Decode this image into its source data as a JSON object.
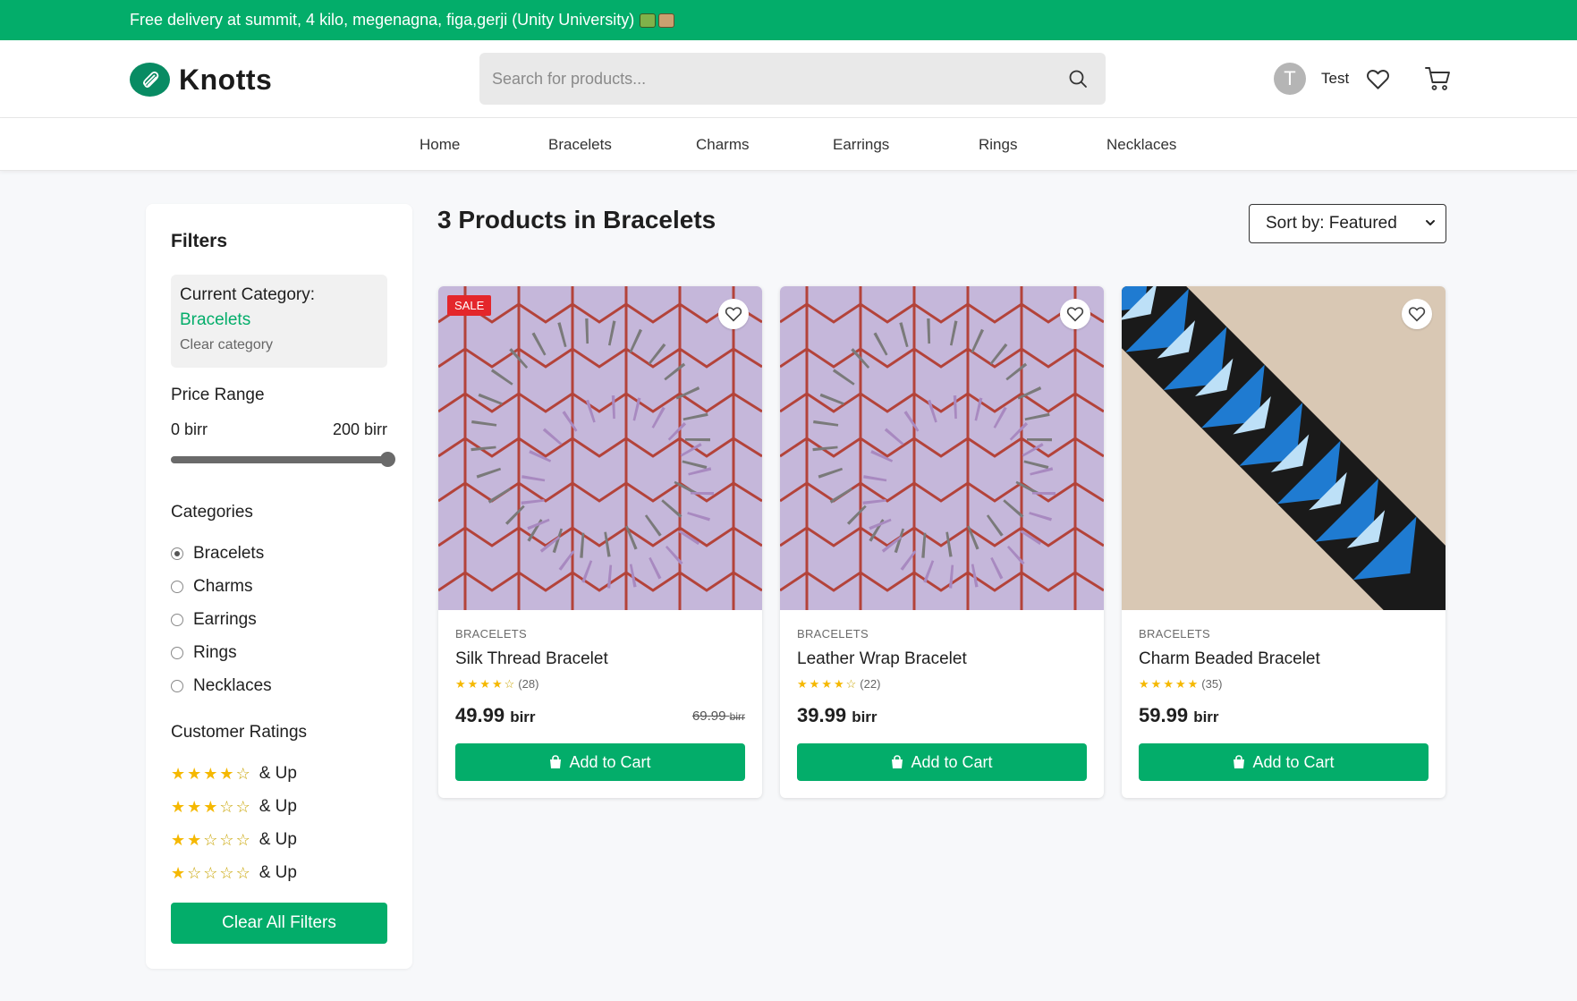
{
  "announcement": {
    "text": "Free delivery at summit, 4 kilo, megenagna, figa,gerji (Unity University)"
  },
  "header": {
    "brand": "Knotts",
    "search": {
      "placeholder": "Search for products..."
    },
    "user": {
      "initial": "T",
      "name": "Test"
    }
  },
  "nav": {
    "items": [
      {
        "label": "Home"
      },
      {
        "label": "Bracelets"
      },
      {
        "label": "Charms"
      },
      {
        "label": "Earrings"
      },
      {
        "label": "Rings"
      },
      {
        "label": "Necklaces"
      }
    ]
  },
  "sidebar": {
    "title": "Filters",
    "current_category_label": "Current Category:",
    "current_category": "Bracelets",
    "clear_category": "Clear category",
    "price_range_title": "Price Range",
    "price_min": "0 birr",
    "price_max": "200 birr",
    "price_slider_fraction": 1.0,
    "categories_title": "Categories",
    "categories": [
      {
        "label": "Bracelets",
        "selected": true
      },
      {
        "label": "Charms",
        "selected": false
      },
      {
        "label": "Earrings",
        "selected": false
      },
      {
        "label": "Rings",
        "selected": false
      },
      {
        "label": "Necklaces",
        "selected": false
      }
    ],
    "ratings_title": "Customer Ratings",
    "ratings": [
      {
        "stars": 4,
        "label": "& Up"
      },
      {
        "stars": 3,
        "label": "& Up"
      },
      {
        "stars": 2,
        "label": "& Up"
      },
      {
        "stars": 1,
        "label": "& Up"
      }
    ],
    "clear_all": "Clear All Filters"
  },
  "main": {
    "results_title": "3 Products in Bracelets",
    "sort_label": "Sort by: Featured",
    "products": [
      {
        "category": "BRACELETS",
        "name": "Silk Thread Bracelet",
        "rating": 4,
        "reviews": "(28)",
        "price": "49.99",
        "currency": "birr",
        "old_price": "69.99",
        "sale_badge": "SALE",
        "add_label": "Add to Cart"
      },
      {
        "category": "BRACELETS",
        "name": "Leather Wrap Bracelet",
        "rating": 4,
        "reviews": "(22)",
        "price": "39.99",
        "currency": "birr",
        "add_label": "Add to Cart"
      },
      {
        "category": "BRACELETS",
        "name": "Charm Beaded Bracelet",
        "rating": 5,
        "reviews": "(35)",
        "price": "59.99",
        "currency": "birr",
        "add_label": "Add to Cart"
      }
    ]
  },
  "colors": {
    "brand_green": "#03ad6a",
    "sale_red": "#e4262b",
    "star_gold": "#f5b800"
  }
}
